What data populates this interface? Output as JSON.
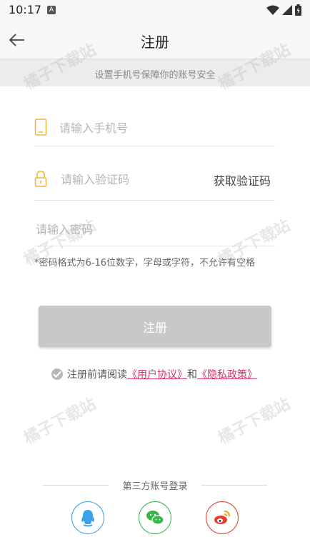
{
  "status_bar": {
    "time": "10:17",
    "notif_badge": "A"
  },
  "header": {
    "title": "注册",
    "back_icon": "arrow-left-icon"
  },
  "subheader": {
    "text": "设置手机号保障你的账号安全"
  },
  "form": {
    "phone": {
      "placeholder": "请输入手机号",
      "icon": "phone-icon"
    },
    "code": {
      "placeholder": "请输入验证码",
      "icon": "lock-icon",
      "get_code_label": "获取验证码"
    },
    "password": {
      "placeholder": "请输入密码"
    },
    "hint": "*密码格式为6-16位数字，字母或字符，不允许有空格"
  },
  "register_button": {
    "label": "注册"
  },
  "agreement": {
    "prefix": "注册前请阅读",
    "user_agreement": "《用户协议》",
    "and": "和",
    "privacy_policy": "《隐私政策》"
  },
  "third_party": {
    "label": "第三方账号登录",
    "options": [
      "qq-icon",
      "wechat-icon",
      "weibo-icon"
    ]
  },
  "watermark": "橘子下载站",
  "colors": {
    "accent": "#d6336c",
    "button_disabled": "#c8c8c8",
    "icon_yellow": "#f0b73a"
  }
}
